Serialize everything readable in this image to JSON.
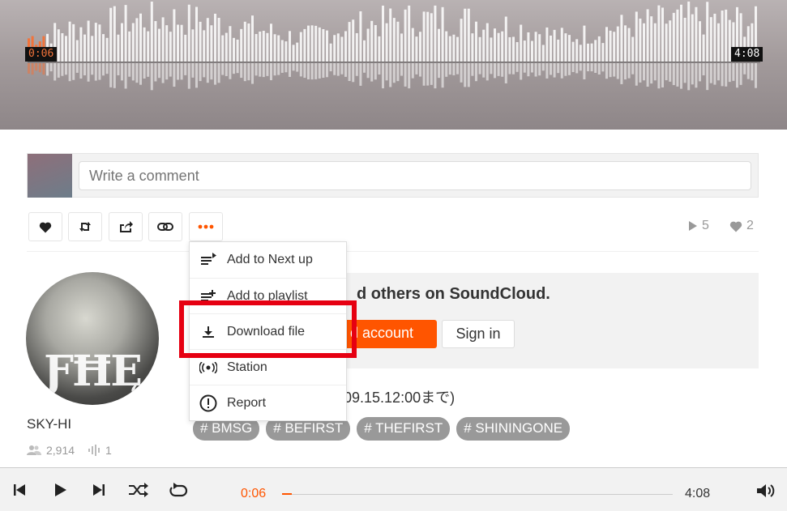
{
  "waveform": {
    "current_time": "0:06",
    "duration": "4:08",
    "progress": 0.024,
    "played_color": "#f2733a",
    "unplayed_color": "#ffffff"
  },
  "comment": {
    "placeholder": "Write a comment"
  },
  "actions": {
    "like_icon": "heart-icon",
    "repost_icon": "repost-icon",
    "share_icon": "share-icon",
    "copy_link_icon": "link-icon",
    "more_icon": "more-icon",
    "plays": "5",
    "likes": "2"
  },
  "menu": {
    "items": [
      {
        "label": "Add to Next up",
        "icon": "next-up-icon"
      },
      {
        "label": "Add to playlist",
        "icon": "playlist-add-icon"
      },
      {
        "label": "Download file",
        "icon": "download-icon"
      },
      {
        "label": "Station",
        "icon": "station-icon"
      },
      {
        "label": "Report",
        "icon": "report-icon"
      }
    ]
  },
  "user": {
    "name": "SKY-HI",
    "followers": "2,914",
    "tracks": "1"
  },
  "signup": {
    "text": "d others on SoundCloud.",
    "create_label": "d account",
    "signin_label": "Sign in"
  },
  "description": {
    "text": "09.15.12:00まで)"
  },
  "tags": [
    "# BMSG",
    "# BEFIRST",
    "# THEFIRST",
    "# SHININGONE"
  ],
  "player": {
    "current_time": "0:06",
    "total_time": "4:08",
    "progress": 0.024,
    "accent_color": "#ff5500"
  },
  "colors": {
    "accent": "#ff5500",
    "highlight_box": "#e60012"
  }
}
